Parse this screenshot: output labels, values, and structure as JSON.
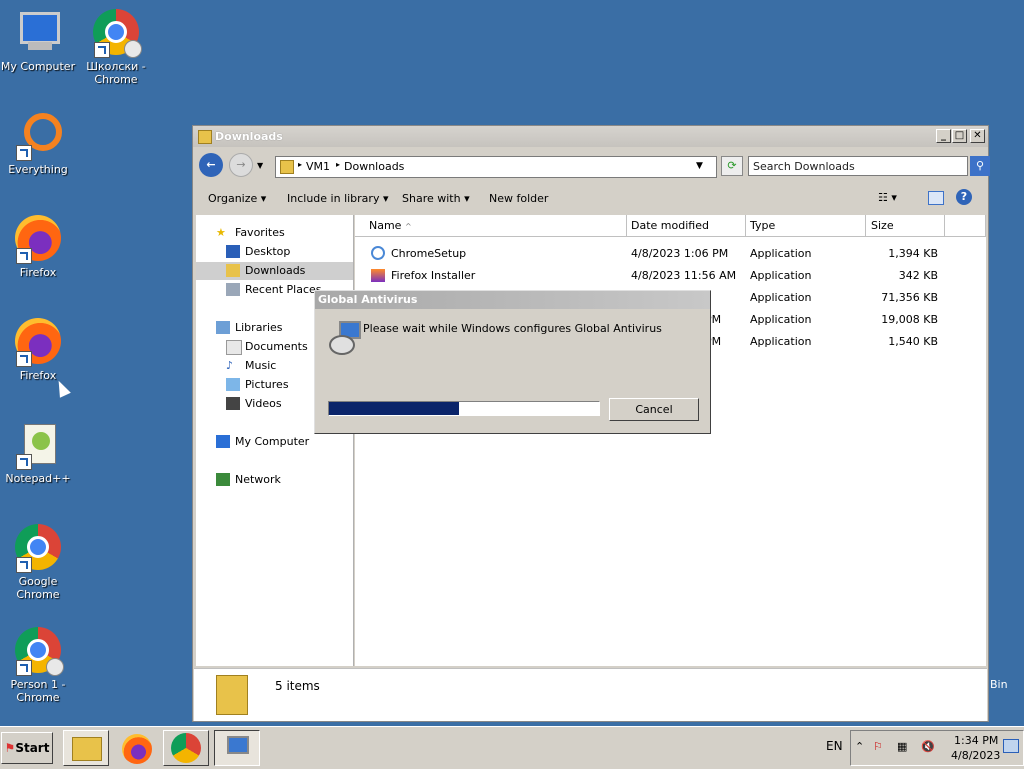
{
  "desktop": {
    "icons": [
      {
        "label": "My Computer"
      },
      {
        "label": "Школски - Chrome"
      },
      {
        "label": "Everything"
      },
      {
        "label": "Firefox"
      },
      {
        "label": "Firefox"
      },
      {
        "label": "Notepad++"
      },
      {
        "label": "Google Chrome"
      },
      {
        "label": "Person 1 - Chrome"
      }
    ],
    "recycle_partial": "Bin"
  },
  "window": {
    "title": "Downloads",
    "breadcrumb": [
      "VM1",
      "Downloads"
    ],
    "search_placeholder": "Search Downloads",
    "toolbar": {
      "organize": "Organize",
      "include": "Include in library",
      "share": "Share with",
      "new_folder": "New folder"
    },
    "nav": {
      "favorites": "Favorites",
      "desktop": "Desktop",
      "downloads": "Downloads",
      "recent": "Recent Places",
      "libraries": "Libraries",
      "documents": "Documents",
      "music": "Music",
      "pictures": "Pictures",
      "videos": "Videos",
      "computer": "My Computer",
      "network": "Network"
    },
    "columns": [
      "Name",
      "Date modified",
      "Type",
      "Size"
    ],
    "files": [
      {
        "name": "ChromeSetup",
        "date": "4/8/2023 1:06 PM",
        "type": "Application",
        "size": "1,394 KB"
      },
      {
        "name": "Firefox Installer",
        "date": "4/8/2023 11:56 AM",
        "type": "Application",
        "size": "342 KB"
      },
      {
        "name": "",
        "date": "M",
        "type": "Application",
        "size": "71,356 KB"
      },
      {
        "name": "",
        "date": "PM",
        "type": "Application",
        "size": "19,008 KB"
      },
      {
        "name": "",
        "date": "PM",
        "type": "Application",
        "size": "1,540 KB"
      }
    ],
    "status": "5 items"
  },
  "dialog": {
    "title": "Global Antivirus",
    "message": "Please wait while Windows configures Global Antivirus",
    "progress_percent": 48,
    "cancel": "Cancel"
  },
  "taskbar": {
    "start": "Start",
    "lang": "EN",
    "time": "1:34 PM",
    "date": "4/8/2023"
  }
}
